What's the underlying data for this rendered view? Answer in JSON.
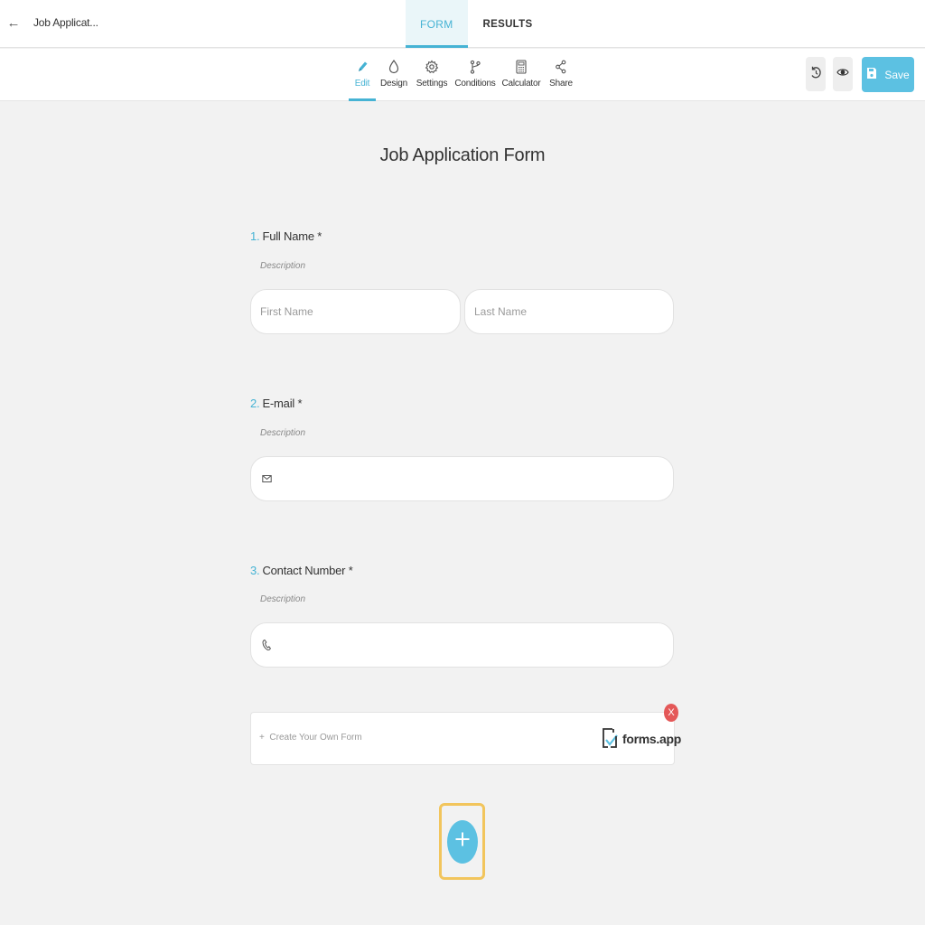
{
  "header": {
    "form_title": "Job Applicat...",
    "tabs": [
      {
        "label": "FORM",
        "active": true
      },
      {
        "label": "RESULTS",
        "active": false
      }
    ]
  },
  "toolbar": {
    "tools": [
      {
        "label": "Edit",
        "icon": "pencil-icon",
        "active": true
      },
      {
        "label": "Design",
        "icon": "drop-icon",
        "active": false
      },
      {
        "label": "Settings",
        "icon": "gear-icon",
        "active": false
      },
      {
        "label": "Conditions",
        "icon": "branch-icon",
        "active": false
      },
      {
        "label": "Calculator",
        "icon": "calculator-icon",
        "active": false
      },
      {
        "label": "Share",
        "icon": "share-icon",
        "active": false
      }
    ],
    "save_label": "Save"
  },
  "form": {
    "title": "Job Application Form",
    "questions": [
      {
        "number": "1.",
        "label": "Full Name *",
        "description": "Description",
        "fields": [
          {
            "placeholder": "First Name"
          },
          {
            "placeholder": "Last Name"
          }
        ]
      },
      {
        "number": "2.",
        "label": "E-mail *",
        "description": "Description",
        "icon": "envelope-icon"
      },
      {
        "number": "3.",
        "label": "Contact Number *",
        "description": "Description",
        "icon": "phone-icon"
      }
    ]
  },
  "promo": {
    "text": "Create Your Own Form",
    "brand": "forms.app",
    "close": "X"
  },
  "colors": {
    "accent": "#46b3d4",
    "save": "#5cc1e2",
    "close": "#e45858",
    "highlight": "#f2c55c"
  }
}
